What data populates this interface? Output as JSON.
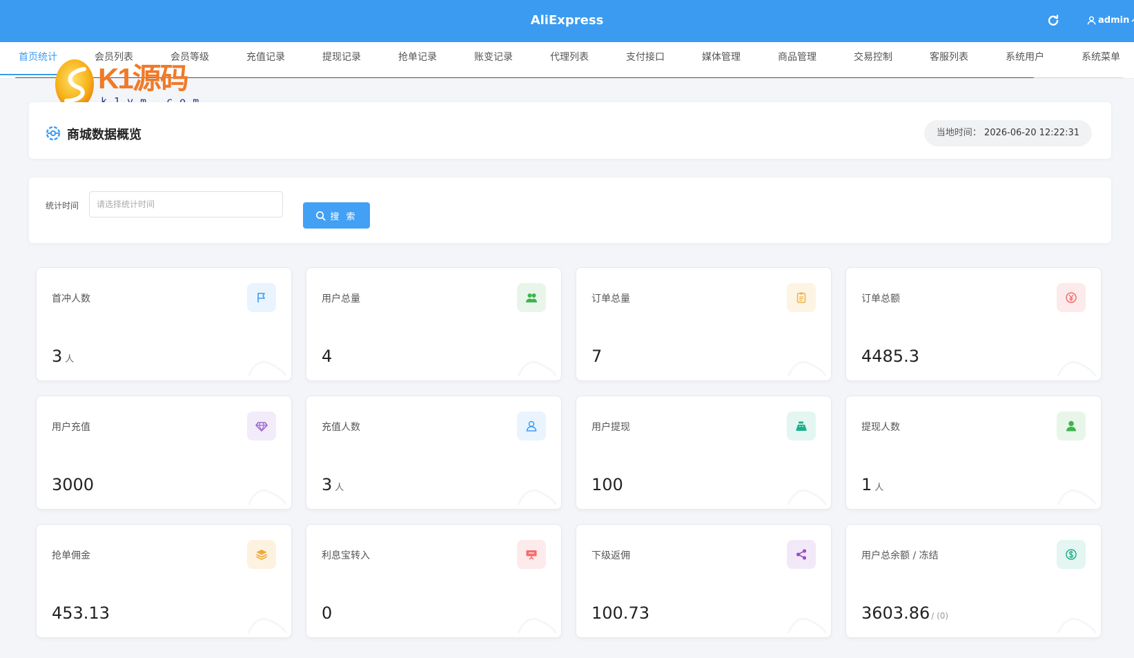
{
  "app": {
    "title": "AliExpress",
    "user": "admin"
  },
  "nav": {
    "items": [
      {
        "label": "首页统计",
        "active": true
      },
      {
        "label": "会员列表"
      },
      {
        "label": "会员等级"
      },
      {
        "label": "充值记录"
      },
      {
        "label": "提现记录"
      },
      {
        "label": "抢单记录"
      },
      {
        "label": "账变记录"
      },
      {
        "label": "代理列表"
      },
      {
        "label": "支付接口"
      },
      {
        "label": "媒体管理"
      },
      {
        "label": "商品管理"
      },
      {
        "label": "交易控制"
      },
      {
        "label": "客服列表"
      },
      {
        "label": "系统用户"
      },
      {
        "label": "系统菜单"
      }
    ]
  },
  "watermark": {
    "text": "K1源码",
    "sub": "k1ym.com"
  },
  "overview": {
    "title": "商城数据概览",
    "time_label": "当地时间：",
    "time_value": "2026-06-20 12:22:31"
  },
  "search": {
    "label": "统计时间",
    "placeholder": "请选择统计时间",
    "value": "",
    "button": "搜 索"
  },
  "stats": [
    {
      "label": "首冲人数",
      "value": "3",
      "unit": "人",
      "icon": "flag-icon",
      "color": "#3a9bf1",
      "bg": "#eaf4fe"
    },
    {
      "label": "用户总量",
      "value": "4",
      "unit": "",
      "icon": "users-icon",
      "color": "#3fb34f",
      "bg": "#e8f6ea"
    },
    {
      "label": "订单总量",
      "value": "7",
      "unit": "",
      "icon": "clipboard-icon",
      "color": "#f0b14a",
      "bg": "#fdf4e4"
    },
    {
      "label": "订单总额",
      "value": "4485.3",
      "unit": "",
      "icon": "yen-icon",
      "color": "#f06e6e",
      "bg": "#fdeaea"
    },
    {
      "label": "用户充值",
      "value": "3000",
      "unit": "",
      "icon": "diamond-icon",
      "color": "#9a6ad0",
      "bg": "#f2ebfa"
    },
    {
      "label": "充值人数",
      "value": "3",
      "unit": "人",
      "icon": "user-outline-icon",
      "color": "#3a9bf1",
      "bg": "#eaf4fe"
    },
    {
      "label": "用户提现",
      "value": "100",
      "unit": "",
      "icon": "cash-register-icon",
      "color": "#1fae8c",
      "bg": "#e3f6f1"
    },
    {
      "label": "提现人数",
      "value": "1",
      "unit": "人",
      "icon": "user-solid-icon",
      "color": "#3fb34f",
      "bg": "#e8f6ea"
    },
    {
      "label": "抢单佣金",
      "value": "453.13",
      "unit": "",
      "icon": "layers-icon",
      "color": "#f0a93a",
      "bg": "#fdf2df"
    },
    {
      "label": "利息宝转入",
      "value": "0",
      "unit": "",
      "icon": "presentation-icon",
      "color": "#f06e6e",
      "bg": "#fdeaea"
    },
    {
      "label": "下级返佣",
      "value": "100.73",
      "unit": "",
      "icon": "share-icon",
      "color": "#9a4fc2",
      "bg": "#f2e9f8"
    },
    {
      "label": "用户总余额 / 冻结",
      "value": "3603.86",
      "unit": "",
      "sub": "/ (0)",
      "icon": "dollar-circle-icon",
      "color": "#1fae8c",
      "bg": "#e3f6f1"
    }
  ]
}
